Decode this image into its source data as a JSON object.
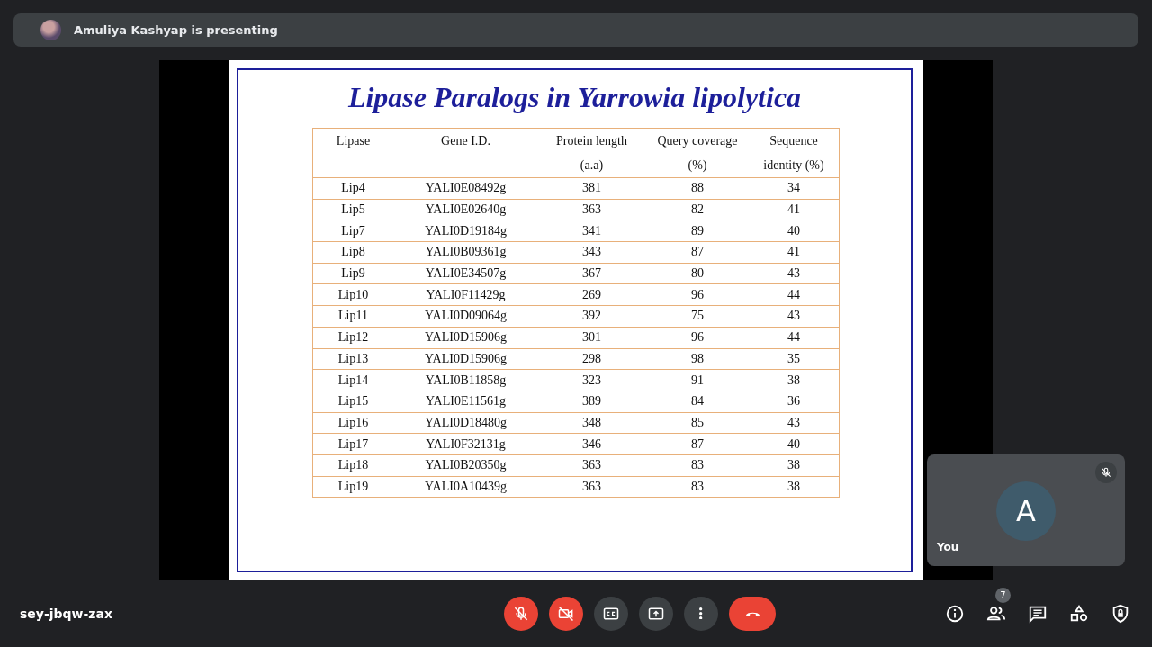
{
  "presenter_banner": {
    "text": "Amuliya Kashyap is presenting"
  },
  "slide": {
    "title": "Lipase Paralogs in Yarrowia lipolytica",
    "table": {
      "columns": [
        "Lipase",
        "Gene I.D.",
        "Protein length\n(a.a)",
        "Query coverage\n(%)",
        "Sequence\nidentity (%)"
      ],
      "rows": [
        [
          "Lip4",
          "YALI0E08492g",
          "381",
          "88",
          "34"
        ],
        [
          "Lip5",
          "YALI0E02640g",
          "363",
          "82",
          "41"
        ],
        [
          "Lip7",
          "YALI0D19184g",
          "341",
          "89",
          "40"
        ],
        [
          "Lip8",
          "YALI0B09361g",
          "343",
          "87",
          "41"
        ],
        [
          "Lip9",
          "YALI0E34507g",
          "367",
          "80",
          "43"
        ],
        [
          "Lip10",
          "YALI0F11429g",
          "269",
          "96",
          "44"
        ],
        [
          "Lip11",
          "YALI0D09064g",
          "392",
          "75",
          "43"
        ],
        [
          "Lip12",
          "YALI0D15906g",
          "301",
          "96",
          "44"
        ],
        [
          "Lip13",
          "YALI0D15906g",
          "298",
          "98",
          "35"
        ],
        [
          "Lip14",
          "YALI0B11858g",
          "323",
          "91",
          "38"
        ],
        [
          "Lip15",
          "YALI0E11561g",
          "389",
          "84",
          "36"
        ],
        [
          "Lip16",
          "YALI0D18480g",
          "348",
          "85",
          "43"
        ],
        [
          "Lip17",
          "YALI0F32131g",
          "346",
          "87",
          "40"
        ],
        [
          "Lip18",
          "YALI0B20350g",
          "363",
          "83",
          "38"
        ],
        [
          "Lip19",
          "YALI0A10439g",
          "363",
          "83",
          "38"
        ]
      ]
    }
  },
  "self_tile": {
    "initial": "A",
    "label": "You",
    "muted": true
  },
  "meeting_code": "sey-jbqw-zax",
  "controls": [
    {
      "kind": "mic",
      "off": true
    },
    {
      "kind": "camera",
      "off": true
    },
    {
      "kind": "captions"
    },
    {
      "kind": "present"
    },
    {
      "kind": "more"
    },
    {
      "kind": "hangup"
    }
  ],
  "side_controls": [
    {
      "kind": "info"
    },
    {
      "kind": "people",
      "badge": "7"
    },
    {
      "kind": "chat"
    },
    {
      "kind": "activities"
    },
    {
      "kind": "safety"
    }
  ]
}
